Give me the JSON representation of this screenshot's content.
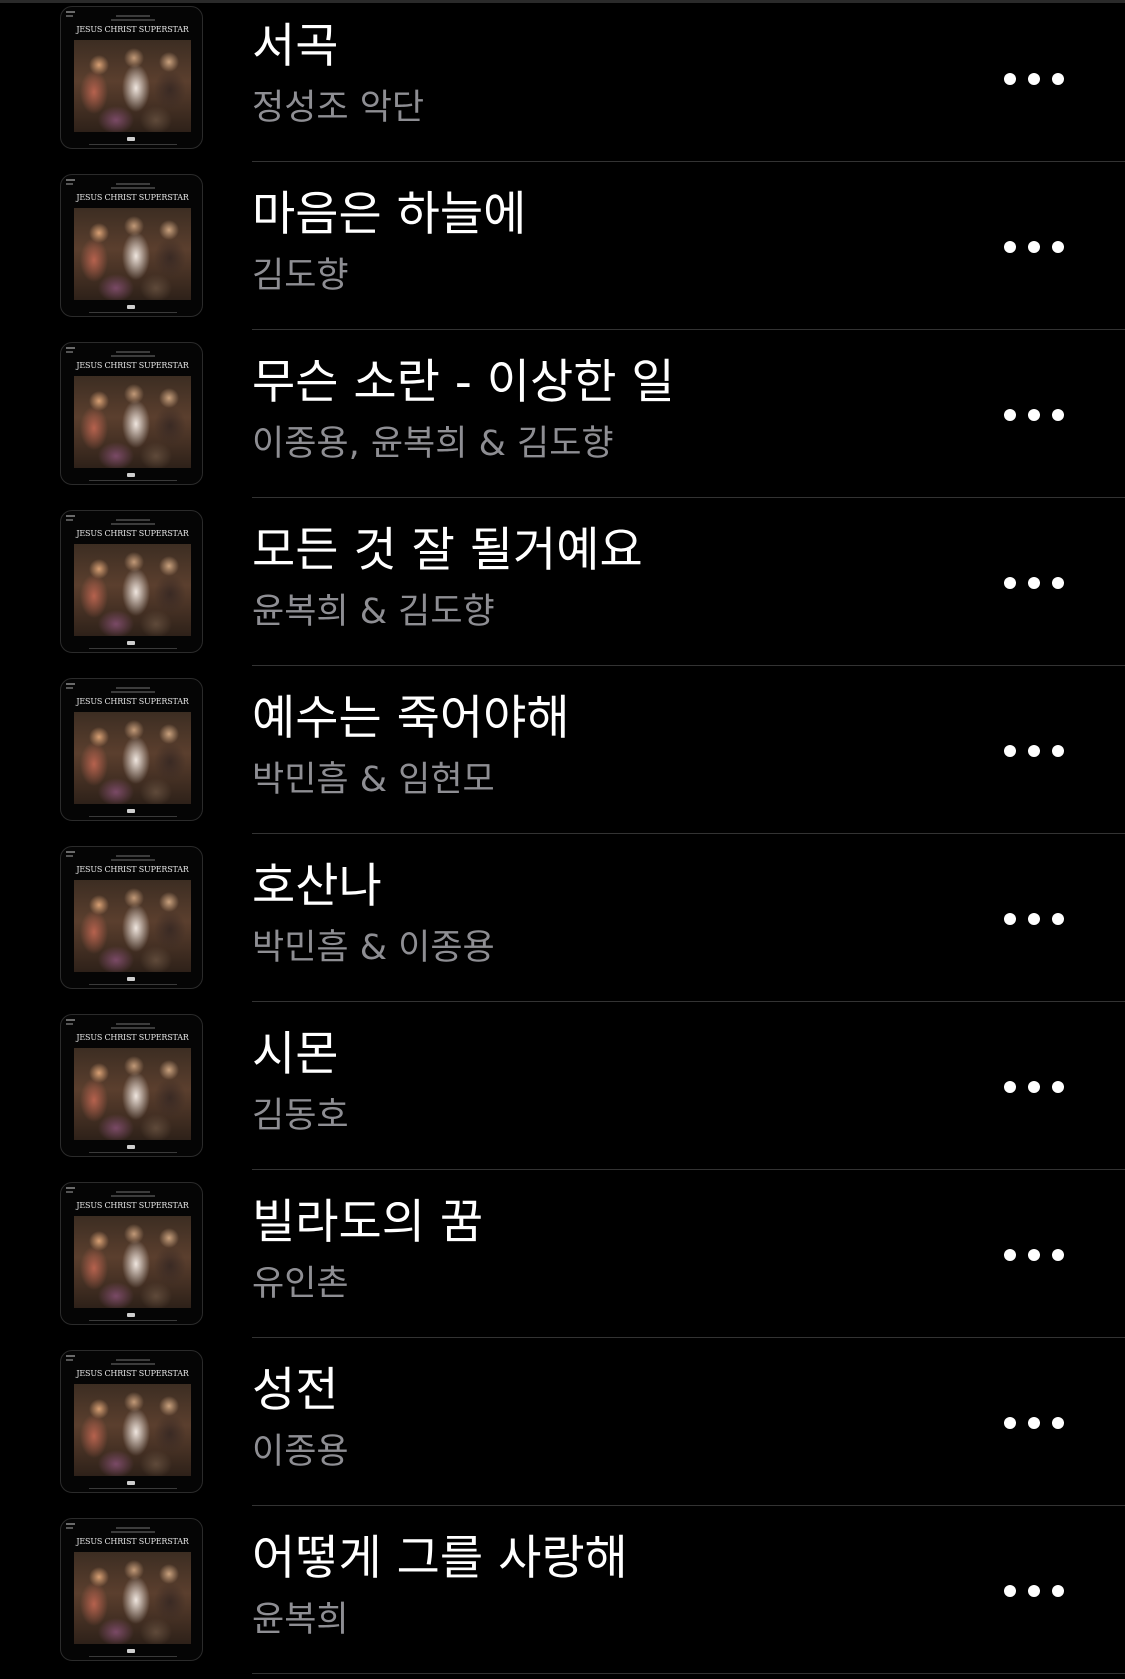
{
  "album": {
    "cover_title": "JESUS CHRIST SUPERSTAR"
  },
  "more_icon": "ellipsis-horizontal-icon",
  "tracks": [
    {
      "title": "서곡",
      "artist": "정성조 악단"
    },
    {
      "title": "마음은 하늘에",
      "artist": "김도향"
    },
    {
      "title": "무슨 소란 - 이상한 일",
      "artist": "이종용, 윤복희 & 김도향"
    },
    {
      "title": "모든 것 잘 될거예요",
      "artist": "윤복희 & 김도향"
    },
    {
      "title": "예수는 죽어야해",
      "artist": "박민흠 & 임현모"
    },
    {
      "title": "호산나",
      "artist": "박민흠 & 이종용"
    },
    {
      "title": "시몬",
      "artist": "김동호"
    },
    {
      "title": "빌라도의 꿈",
      "artist": "유인촌"
    },
    {
      "title": "성전",
      "artist": "이종용"
    },
    {
      "title": "어떻게 그를 사랑해",
      "artist": "윤복희"
    }
  ]
}
